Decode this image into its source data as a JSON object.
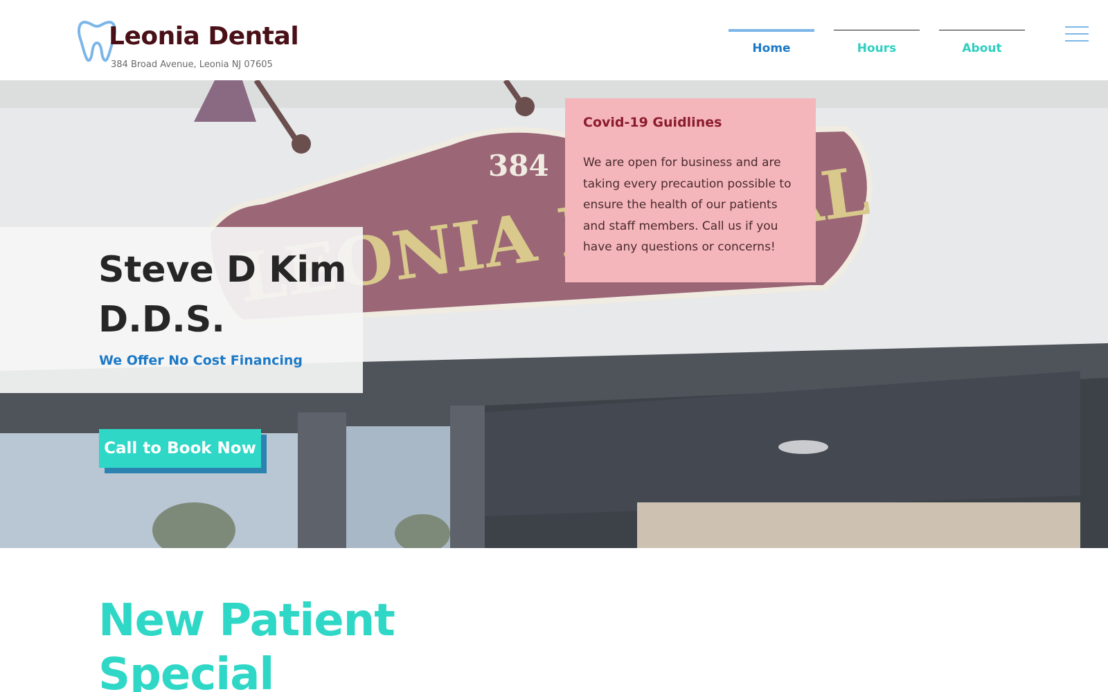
{
  "header": {
    "brand": "Leonia Dental",
    "address": "384 Broad Avenue, Leonia NJ 07605",
    "nav": [
      {
        "label": "Home",
        "active": true
      },
      {
        "label": "Hours",
        "active": false
      },
      {
        "label": "About",
        "active": false
      }
    ],
    "menu_icon": "hamburger-menu-icon",
    "logo_icon": "tooth-icon"
  },
  "hero": {
    "photo_sign_number": "384",
    "photo_sign_text": "LEONIA DENTAL",
    "name": "Steve D Kim D.D.S.",
    "financing": "We Offer No Cost Financing",
    "cta": "Call to Book Now",
    "covid": {
      "title": "Covid-19 Guidlines",
      "body": "We are open for business and are taking every precaution possible to ensure the health of our patients and staff members. Call us if you have any questions or concerns!"
    }
  },
  "special": {
    "title": "New Patient Special"
  },
  "colors": {
    "brand": "#4a1017",
    "teal": "#2fd7c6",
    "blue": "#1c79c6",
    "covid_bg": "#f4b6bb",
    "covid_title": "#8c1c2d"
  }
}
